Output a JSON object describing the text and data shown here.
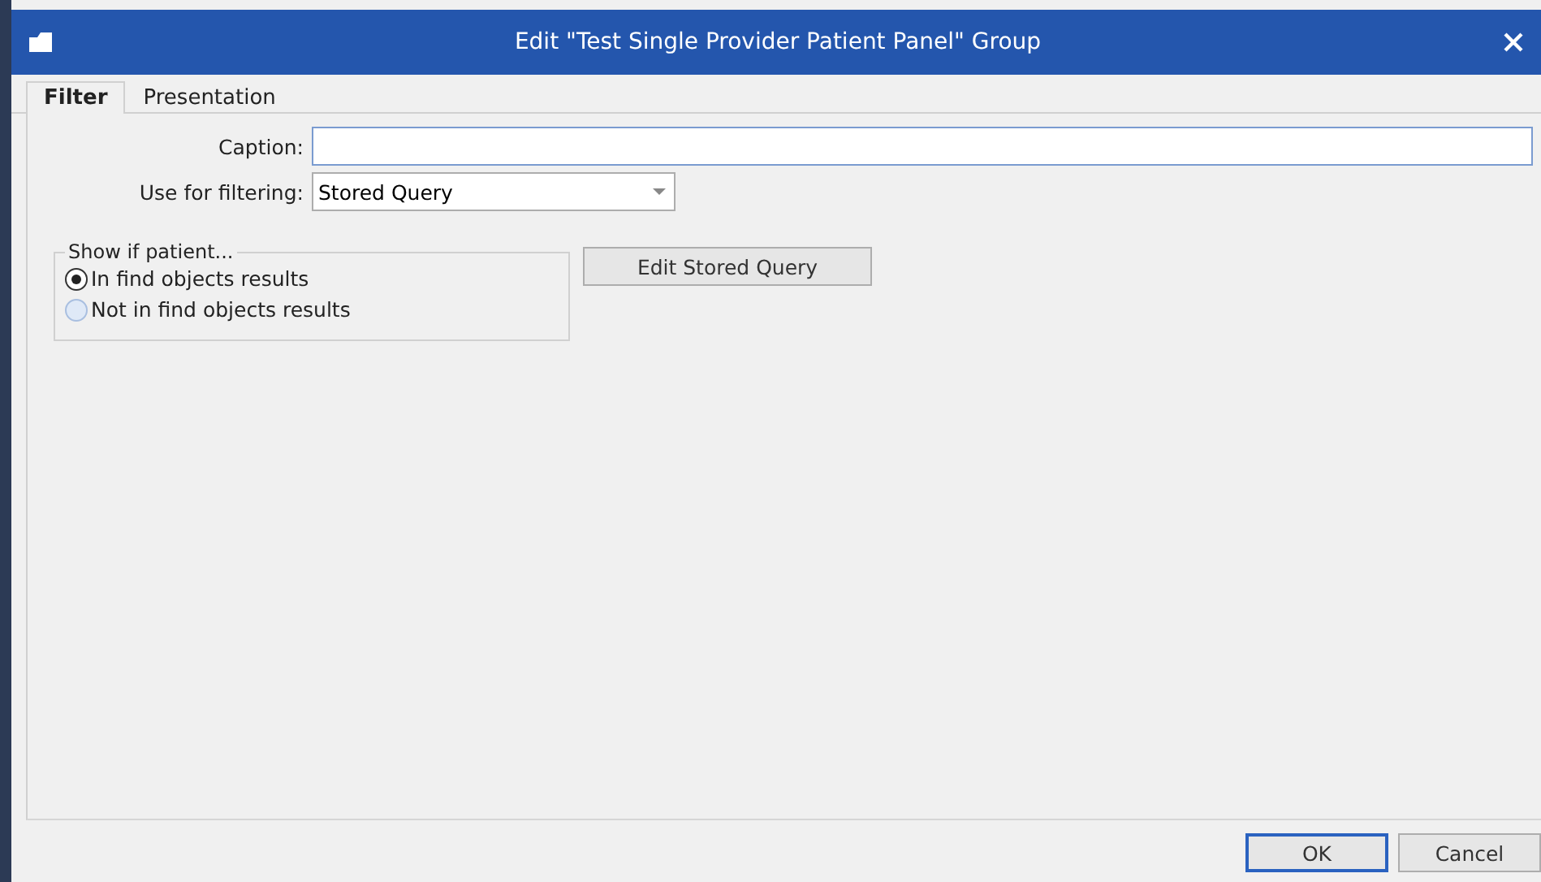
{
  "window": {
    "title": "Edit \"Test Single Provider Patient Panel\" Group"
  },
  "tabs": [
    {
      "label": "Filter",
      "selected": true
    },
    {
      "label": "Presentation",
      "selected": false
    }
  ],
  "form": {
    "caption": {
      "label": "Caption:"
    },
    "use_for_filtering": {
      "label": "Use for filtering:",
      "value": "Stored Query"
    }
  },
  "show_if_patient": {
    "legend": "Show if patient...",
    "options": [
      {
        "label": "In find objects results",
        "selected": true
      },
      {
        "label": "Not in find objects results",
        "selected": false
      }
    ]
  },
  "edit_stored_query_button": "Edit Stored Query",
  "buttons": [
    {
      "label": "OK",
      "default": true
    },
    {
      "label": "Cancel",
      "default": false
    }
  ]
}
